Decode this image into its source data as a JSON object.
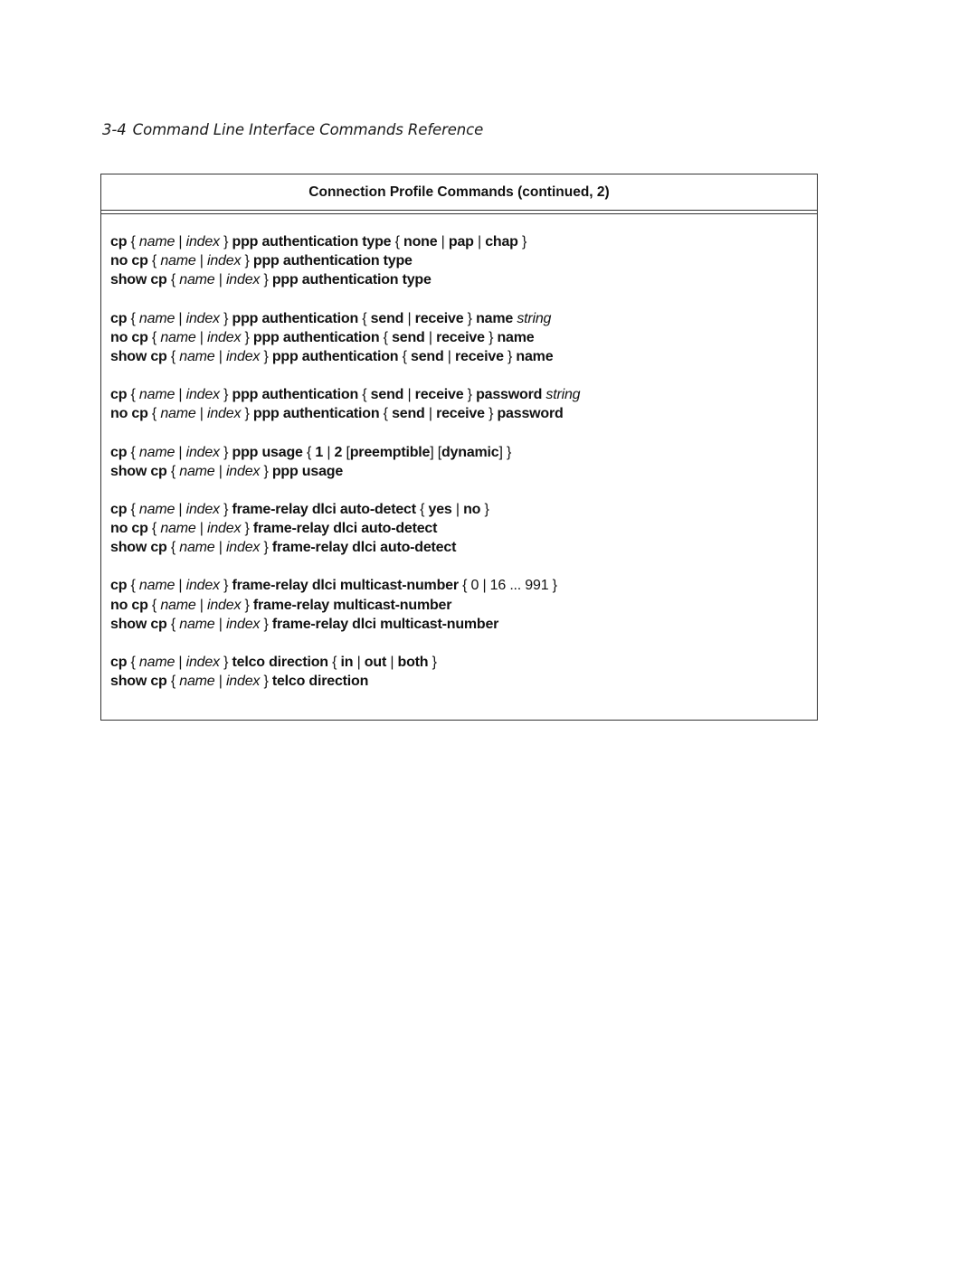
{
  "page_header": {
    "page_number": "3-4",
    "title": "Command Line Interface Commands Reference"
  },
  "table": {
    "title": "Connection Profile Commands (continued, 2)",
    "groups": [
      {
        "lines": [
          [
            [
              "b",
              "cp"
            ],
            [
              "p",
              " { "
            ],
            [
              "i",
              "name"
            ],
            [
              "p",
              " | "
            ],
            [
              "i",
              "index"
            ],
            [
              "p",
              " } "
            ],
            [
              "b",
              "ppp authentication type"
            ],
            [
              "p",
              " { "
            ],
            [
              "b",
              "none"
            ],
            [
              "p",
              " | "
            ],
            [
              "b",
              "pap"
            ],
            [
              "p",
              " | "
            ],
            [
              "b",
              "chap"
            ],
            [
              "p",
              " }"
            ]
          ],
          [
            [
              "b",
              "no cp"
            ],
            [
              "p",
              " { "
            ],
            [
              "i",
              "name"
            ],
            [
              "p",
              " | "
            ],
            [
              "i",
              "index"
            ],
            [
              "p",
              " } "
            ],
            [
              "b",
              "ppp authentication type"
            ]
          ],
          [
            [
              "b",
              "show cp"
            ],
            [
              "p",
              " { "
            ],
            [
              "i",
              "name"
            ],
            [
              "p",
              " | "
            ],
            [
              "i",
              "index"
            ],
            [
              "p",
              " } "
            ],
            [
              "b",
              "ppp authentication type"
            ]
          ]
        ]
      },
      {
        "lines": [
          [
            [
              "b",
              "cp"
            ],
            [
              "p",
              " { "
            ],
            [
              "i",
              "name"
            ],
            [
              "p",
              " | "
            ],
            [
              "i",
              "index"
            ],
            [
              "p",
              " } "
            ],
            [
              "b",
              "ppp authentication"
            ],
            [
              "p",
              " { "
            ],
            [
              "b",
              "send"
            ],
            [
              "p",
              " | "
            ],
            [
              "b",
              "receive"
            ],
            [
              "p",
              " } "
            ],
            [
              "b",
              "name"
            ],
            [
              "p",
              " "
            ],
            [
              "i",
              "string"
            ]
          ],
          [
            [
              "b",
              "no cp"
            ],
            [
              "p",
              " { "
            ],
            [
              "i",
              "name"
            ],
            [
              "p",
              " | "
            ],
            [
              "i",
              "index"
            ],
            [
              "p",
              " } "
            ],
            [
              "b",
              "ppp authentication"
            ],
            [
              "p",
              " { "
            ],
            [
              "b",
              "send"
            ],
            [
              "p",
              " | "
            ],
            [
              "b",
              "receive"
            ],
            [
              "p",
              " } "
            ],
            [
              "b",
              "name"
            ]
          ],
          [
            [
              "b",
              "show cp"
            ],
            [
              "p",
              " { "
            ],
            [
              "i",
              "name"
            ],
            [
              "p",
              " | "
            ],
            [
              "i",
              "index"
            ],
            [
              "p",
              " } "
            ],
            [
              "b",
              "ppp authentication"
            ],
            [
              "p",
              " { "
            ],
            [
              "b",
              "send"
            ],
            [
              "p",
              " | "
            ],
            [
              "b",
              "receive"
            ],
            [
              "p",
              " } "
            ],
            [
              "b",
              "name"
            ]
          ]
        ]
      },
      {
        "lines": [
          [
            [
              "b",
              "cp"
            ],
            [
              "p",
              " { "
            ],
            [
              "i",
              "name"
            ],
            [
              "p",
              " | "
            ],
            [
              "i",
              "index"
            ],
            [
              "p",
              " } "
            ],
            [
              "b",
              "ppp authentication"
            ],
            [
              "p",
              " { "
            ],
            [
              "b",
              "send"
            ],
            [
              "p",
              " | "
            ],
            [
              "b",
              "receive"
            ],
            [
              "p",
              " } "
            ],
            [
              "b",
              "password"
            ],
            [
              "p",
              " "
            ],
            [
              "i",
              "string"
            ]
          ],
          [
            [
              "b",
              "no cp"
            ],
            [
              "p",
              " { "
            ],
            [
              "i",
              "name"
            ],
            [
              "p",
              " | "
            ],
            [
              "i",
              "index"
            ],
            [
              "p",
              " } "
            ],
            [
              "b",
              "ppp authentication"
            ],
            [
              "p",
              " { "
            ],
            [
              "b",
              "send"
            ],
            [
              "p",
              " | "
            ],
            [
              "b",
              "receive"
            ],
            [
              "p",
              " } "
            ],
            [
              "b",
              "password"
            ]
          ]
        ]
      },
      {
        "lines": [
          [
            [
              "b",
              "cp"
            ],
            [
              "p",
              " { "
            ],
            [
              "i",
              "name"
            ],
            [
              "p",
              " | "
            ],
            [
              "i",
              "index"
            ],
            [
              "p",
              " } "
            ],
            [
              "b",
              "ppp usage"
            ],
            [
              "p",
              " { "
            ],
            [
              "b",
              "1"
            ],
            [
              "p",
              " | "
            ],
            [
              "b",
              "2"
            ],
            [
              "p",
              " ["
            ],
            [
              "b",
              "preemptible"
            ],
            [
              "p",
              "] ["
            ],
            [
              "b",
              "dynamic"
            ],
            [
              "p",
              "] }"
            ]
          ],
          [
            [
              "b",
              "show cp"
            ],
            [
              "p",
              " { "
            ],
            [
              "i",
              "name"
            ],
            [
              "p",
              " | "
            ],
            [
              "i",
              "index"
            ],
            [
              "p",
              " } "
            ],
            [
              "b",
              "ppp usage"
            ]
          ]
        ]
      },
      {
        "lines": [
          [
            [
              "b",
              "cp"
            ],
            [
              "p",
              " { "
            ],
            [
              "i",
              "name"
            ],
            [
              "p",
              " | "
            ],
            [
              "i",
              "index"
            ],
            [
              "p",
              " } "
            ],
            [
              "b",
              "frame-relay dlci auto-detect"
            ],
            [
              "p",
              " { "
            ],
            [
              "b",
              "yes"
            ],
            [
              "p",
              " | "
            ],
            [
              "b",
              "no"
            ],
            [
              "p",
              " }"
            ]
          ],
          [
            [
              "b",
              "no cp"
            ],
            [
              "p",
              " { "
            ],
            [
              "i",
              "name"
            ],
            [
              "p",
              " | "
            ],
            [
              "i",
              "index"
            ],
            [
              "p",
              " } "
            ],
            [
              "b",
              "frame-relay dlci auto-detect"
            ]
          ],
          [
            [
              "b",
              "show cp"
            ],
            [
              "p",
              " { "
            ],
            [
              "i",
              "name"
            ],
            [
              "p",
              " | "
            ],
            [
              "i",
              "index"
            ],
            [
              "p",
              " } "
            ],
            [
              "b",
              "frame-relay dlci auto-detect"
            ]
          ]
        ]
      },
      {
        "lines": [
          [
            [
              "b",
              "cp"
            ],
            [
              "p",
              " { "
            ],
            [
              "i",
              "name"
            ],
            [
              "p",
              " | "
            ],
            [
              "i",
              "index"
            ],
            [
              "p",
              " } "
            ],
            [
              "b",
              "frame-relay dlci multicast-number"
            ],
            [
              "p",
              " { 0 | 16 ... 991 }"
            ]
          ],
          [
            [
              "b",
              "no cp"
            ],
            [
              "p",
              " { "
            ],
            [
              "i",
              "name"
            ],
            [
              "p",
              " | "
            ],
            [
              "i",
              "index"
            ],
            [
              "p",
              " } "
            ],
            [
              "b",
              "frame-relay multicast-number"
            ]
          ],
          [
            [
              "b",
              "show cp"
            ],
            [
              "p",
              " { "
            ],
            [
              "i",
              "name"
            ],
            [
              "p",
              " | "
            ],
            [
              "i",
              "index"
            ],
            [
              "p",
              " } "
            ],
            [
              "b",
              "frame-relay dlci multicast-number"
            ]
          ]
        ]
      },
      {
        "lines": [
          [
            [
              "b",
              "cp"
            ],
            [
              "p",
              " { "
            ],
            [
              "i",
              "name"
            ],
            [
              "p",
              " | "
            ],
            [
              "i",
              "index"
            ],
            [
              "p",
              " } "
            ],
            [
              "b",
              "telco direction"
            ],
            [
              "p",
              " { "
            ],
            [
              "b",
              "in"
            ],
            [
              "p",
              " | "
            ],
            [
              "b",
              "out"
            ],
            [
              "p",
              " | "
            ],
            [
              "b",
              "both"
            ],
            [
              "p",
              " }"
            ]
          ],
          [
            [
              "b",
              "show cp"
            ],
            [
              "p",
              " { "
            ],
            [
              "i",
              "name"
            ],
            [
              "p",
              " | "
            ],
            [
              "i",
              "index"
            ],
            [
              "p",
              " } "
            ],
            [
              "b",
              "telco direction"
            ]
          ]
        ]
      }
    ]
  }
}
